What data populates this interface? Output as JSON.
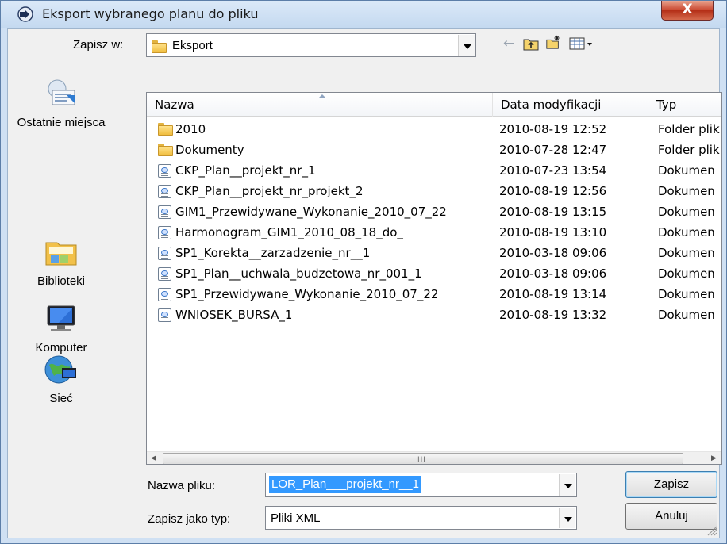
{
  "window": {
    "title": "Eksport wybranego planu do pliku",
    "close_glyph": "X"
  },
  "toolbar": {
    "save_in_label": "Zapisz w:",
    "location": "Eksport",
    "icons": [
      "back-arrow-icon",
      "up-folder-icon",
      "new-folder-icon",
      "view-menu-icon"
    ]
  },
  "places": [
    {
      "label": "Ostatnie miejsca",
      "icon": "recent-places-icon"
    },
    {
      "label": "Biblioteki",
      "icon": "libraries-icon"
    },
    {
      "label": "Komputer",
      "icon": "computer-icon"
    },
    {
      "label": "Sieć",
      "icon": "network-icon"
    }
  ],
  "list": {
    "columns": [
      "Nazwa",
      "Data modyfikacji",
      "Typ"
    ],
    "rows": [
      {
        "name": "2010",
        "date": "2010-08-19 12:52",
        "type": "Folder plik",
        "kind": "folder"
      },
      {
        "name": "Dokumenty",
        "date": "2010-07-28 12:47",
        "type": "Folder plik",
        "kind": "folder"
      },
      {
        "name": "CKP_Plan__projekt_nr_1",
        "date": "2010-07-23 13:54",
        "type": "Dokumen",
        "kind": "doc"
      },
      {
        "name": "CKP_Plan__projekt_nr_projekt_2",
        "date": "2010-08-19 12:56",
        "type": "Dokumen",
        "kind": "doc"
      },
      {
        "name": "GIM1_Przewidywane_Wykonanie_2010_07_22",
        "date": "2010-08-19 13:15",
        "type": "Dokumen",
        "kind": "doc"
      },
      {
        "name": "Harmonogram_GIM1_2010_08_18_do_",
        "date": "2010-08-19 13:10",
        "type": "Dokumen",
        "kind": "doc"
      },
      {
        "name": "SP1_Korekta__zarzadzenie_nr__1",
        "date": "2010-03-18 09:06",
        "type": "Dokumen",
        "kind": "doc"
      },
      {
        "name": "SP1_Plan__uchwala_budzetowa_nr_001_1",
        "date": "2010-03-18 09:06",
        "type": "Dokumen",
        "kind": "doc"
      },
      {
        "name": "SP1_Przewidywane_Wykonanie_2010_07_22",
        "date": "2010-08-19 13:14",
        "type": "Dokumen",
        "kind": "doc"
      },
      {
        "name": "WNIOSEK_BURSA_1",
        "date": "2010-08-19 13:32",
        "type": "Dokumen",
        "kind": "doc"
      }
    ],
    "scrollbar_grip": "III"
  },
  "form": {
    "filename_label": "Nazwa pliku:",
    "filename_value": "LOR_Plan___projekt_nr__1",
    "filetype_label": "Zapisz jako typ:",
    "filetype_value": "Pliki XML",
    "save_button": "Zapisz",
    "cancel_button": "Anuluj"
  },
  "colors": {
    "selection": "#3399ff",
    "close_button": "#c9452d",
    "title_bar": "#c4d9f0"
  }
}
